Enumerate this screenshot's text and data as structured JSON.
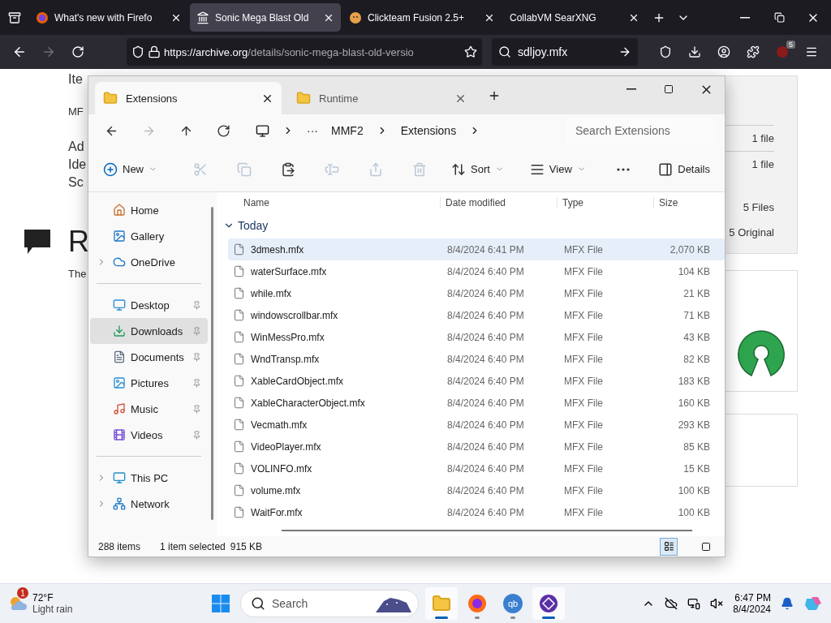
{
  "browser": {
    "tabs": [
      {
        "title": "What's new with Firefo",
        "selected": false
      },
      {
        "title": "Sonic Mega Blast Old",
        "selected": true
      },
      {
        "title": "Clickteam Fusion 2.5+",
        "selected": false
      },
      {
        "title": "CollabVM SearXNG",
        "selected": false
      }
    ],
    "url_host": "https://archive.org",
    "url_path": "/details/sonic-mega-blast-old-versio",
    "search_value": "sdljoy.mfx",
    "extension_badge": "5"
  },
  "page": {
    "left_texts": [
      "Ite",
      "MF",
      "Ad",
      "Ide",
      "Sc"
    ],
    "heading": "R",
    "paragraph": "The",
    "file_counts": [
      "1 file",
      "1 file",
      "5 Files",
      "5 Original"
    ]
  },
  "explorer": {
    "tabs": [
      {
        "title": "Extensions",
        "selected": true
      },
      {
        "title": "Runtime",
        "selected": false
      }
    ],
    "nav": [
      {
        "disabled": false
      },
      {
        "disabled": true
      },
      {
        "disabled": false
      },
      {
        "disabled": false
      }
    ],
    "breadcrumb": {
      "overflow": "···",
      "parts": [
        "MMF2",
        "Extensions"
      ]
    },
    "search": {
      "placeholder": "Search Extensions"
    },
    "commands": [
      {
        "kind": "menu",
        "label": "New",
        "disabled": false
      },
      {
        "kind": "icon",
        "disabled": true
      },
      {
        "kind": "icon",
        "disabled": true
      },
      {
        "kind": "icon",
        "disabled": false
      },
      {
        "kind": "icon",
        "disabled": true
      },
      {
        "kind": "icon",
        "disabled": true
      },
      {
        "kind": "icon",
        "disabled": true
      },
      {
        "kind": "menu",
        "label": "Sort",
        "disabled": false
      },
      {
        "kind": "menu",
        "label": "View",
        "disabled": false
      },
      {
        "kind": "icon",
        "disabled": false
      },
      {
        "kind": "toggle",
        "label": "Details",
        "disabled": false
      }
    ],
    "sidebar": [
      [
        {
          "label": "Home",
          "selected": false,
          "pinned": false,
          "expandable": false
        },
        {
          "label": "Gallery",
          "selected": false,
          "pinned": false,
          "expandable": false
        },
        {
          "label": "OneDrive",
          "selected": false,
          "pinned": false,
          "expandable": true
        }
      ],
      [
        {
          "label": "Desktop",
          "selected": false,
          "pinned": true,
          "expandable": false
        },
        {
          "label": "Downloads",
          "selected": true,
          "pinned": true,
          "expandable": false
        },
        {
          "label": "Documents",
          "selected": false,
          "pinned": true,
          "expandable": false
        },
        {
          "label": "Pictures",
          "selected": false,
          "pinned": true,
          "expandable": false
        },
        {
          "label": "Music",
          "selected": false,
          "pinned": true,
          "expandable": false
        },
        {
          "label": "Videos",
          "selected": false,
          "pinned": true,
          "expandable": false
        }
      ],
      [
        {
          "label": "This PC",
          "selected": false,
          "pinned": false,
          "expandable": true
        },
        {
          "label": "Network",
          "selected": false,
          "pinned": false,
          "expandable": true
        }
      ]
    ],
    "columns": [
      "Name",
      "Date modified",
      "Type",
      "Size"
    ],
    "group": {
      "label": "Today",
      "expanded": true
    },
    "files": [
      {
        "name": "3dmesh.mfx",
        "date": "8/4/2024 6:41 PM",
        "type": "MFX File",
        "size": "2,070 KB",
        "selected": true
      },
      {
        "name": "waterSurface.mfx",
        "date": "8/4/2024 6:40 PM",
        "type": "MFX File",
        "size": "104 KB",
        "selected": false
      },
      {
        "name": "while.mfx",
        "date": "8/4/2024 6:40 PM",
        "type": "MFX File",
        "size": "21 KB",
        "selected": false
      },
      {
        "name": "windowscrollbar.mfx",
        "date": "8/4/2024 6:40 PM",
        "type": "MFX File",
        "size": "71 KB",
        "selected": false
      },
      {
        "name": "WinMessPro.mfx",
        "date": "8/4/2024 6:40 PM",
        "type": "MFX File",
        "size": "43 KB",
        "selected": false
      },
      {
        "name": "WndTransp.mfx",
        "date": "8/4/2024 6:40 PM",
        "type": "MFX File",
        "size": "82 KB",
        "selected": false
      },
      {
        "name": "XableCardObject.mfx",
        "date": "8/4/2024 6:40 PM",
        "type": "MFX File",
        "size": "183 KB",
        "selected": false
      },
      {
        "name": "XableCharacterObject.mfx",
        "date": "8/4/2024 6:40 PM",
        "type": "MFX File",
        "size": "160 KB",
        "selected": false
      },
      {
        "name": "Vecmath.mfx",
        "date": "8/4/2024 6:40 PM",
        "type": "MFX File",
        "size": "293 KB",
        "selected": false
      },
      {
        "name": "VideoPlayer.mfx",
        "date": "8/4/2024 6:40 PM",
        "type": "MFX File",
        "size": "85 KB",
        "selected": false
      },
      {
        "name": "VOLINFO.mfx",
        "date": "8/4/2024 6:40 PM",
        "type": "MFX File",
        "size": "15 KB",
        "selected": false
      },
      {
        "name": "volume.mfx",
        "date": "8/4/2024 6:40 PM",
        "type": "MFX File",
        "size": "100 KB",
        "selected": false
      },
      {
        "name": "WaitFor.mfx",
        "date": "8/4/2024 6:40 PM",
        "type": "MFX File",
        "size": "100 KB",
        "selected": false
      }
    ],
    "status": {
      "items": "288 items",
      "selection": "1 item selected",
      "size": "915 KB"
    },
    "views": [
      {
        "selected": true
      },
      {
        "selected": false
      }
    ]
  },
  "taskbar": {
    "weather": {
      "badge": "1",
      "temp": "72°F",
      "condition": "Light rain"
    },
    "search_placeholder": "Search",
    "apps": [
      {
        "kind": "folder",
        "active": true
      },
      {
        "kind": "fox",
        "active": false
      },
      {
        "kind": "letters",
        "label": "qb",
        "active": false
      },
      {
        "kind": "diamond",
        "active": true
      }
    ],
    "time": "6:47 PM",
    "date": "8/4/2024"
  }
}
